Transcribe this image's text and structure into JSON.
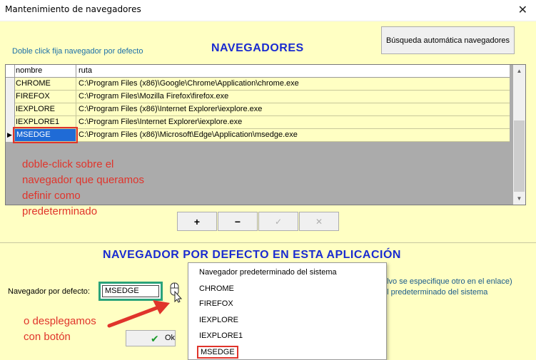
{
  "window": {
    "title": "Mantenimiento de navegadores",
    "close_glyph": "✕"
  },
  "top": {
    "hint": "Doble click fija navegador por defecto",
    "heading": "NAVEGADORES",
    "auto_button": "Búsqueda automática navegadores"
  },
  "grid": {
    "columns": [
      "nombre",
      "ruta"
    ],
    "rows": [
      {
        "name": "CHROME",
        "path": "C:\\Program Files (x86)\\Google\\Chrome\\Application\\chrome.exe"
      },
      {
        "name": "FIREFOX",
        "path": "C:\\Program Files\\Mozilla Firefox\\firefox.exe"
      },
      {
        "name": "IEXPLORE",
        "path": "C:\\Program Files (x86)\\Internet Explorer\\iexplore.exe"
      },
      {
        "name": "IEXPLORE1",
        "path": "C:\\Program Files\\Internet Explorer\\iexplore.exe"
      },
      {
        "name": "MSEDGE",
        "path": "C:\\Program Files (x86)\\Microsoft\\Edge\\Application\\msedge.exe"
      }
    ],
    "current_row_marker": "▶"
  },
  "annotations": {
    "dblclick": [
      "doble-click sobre el",
      "navegador que queramos",
      "definir como",
      "predeterminado"
    ],
    "dropdown": [
      "o desplegamos",
      "con botón"
    ]
  },
  "toolbar": {
    "add": "+",
    "remove": "−",
    "confirm": "✓",
    "cancel": "✕"
  },
  "bottom": {
    "heading": "NAVEGADOR POR DEFECTO EN ESTA APLICACIÓN",
    "default_label": "Navegador por defecto:",
    "default_value": "MSEDGE",
    "side_note1": "alvo se especifique otro en el enlace)",
    "side_note2": "el predeterminado del sistema",
    "ok_label": "Ok"
  },
  "dropdown": {
    "options": [
      "Navegador predeterminado del sistema",
      "CHROME",
      "FIREFOX",
      "IEXPLORE",
      "IEXPLORE1",
      "MSEDGE"
    ]
  },
  "colors": {
    "panel": "#ffffc3",
    "heading": "#1a2bd0",
    "annotation": "#e0342b",
    "selection": "#1f6bd6"
  }
}
